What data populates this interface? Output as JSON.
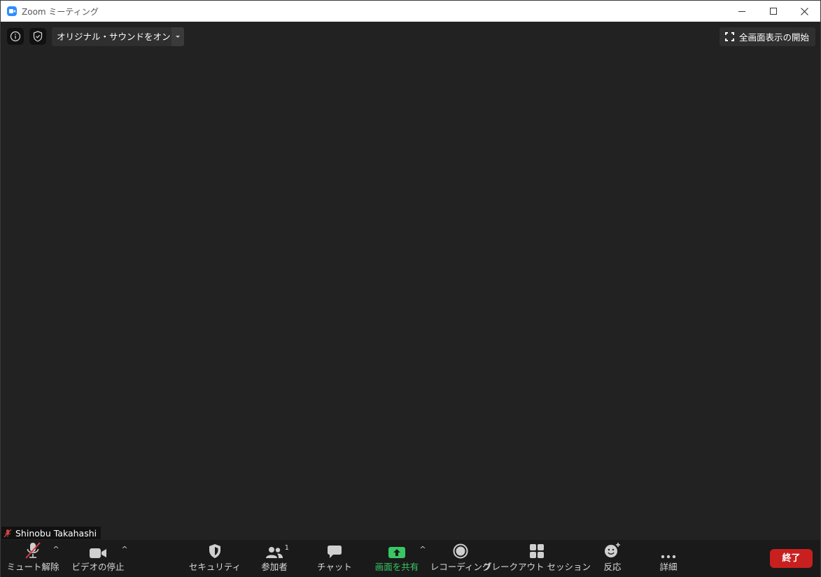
{
  "window": {
    "title": "Zoom ミーティング"
  },
  "top_bar": {
    "original_sound_label": "オリジナル・サウンドをオンにする",
    "fullscreen_label": "全画面表示の開始"
  },
  "participant": {
    "name": "Shinobu Takahashi",
    "muted": true
  },
  "toolbar": {
    "unmute_label": "ミュート解除",
    "stop_video_label": "ビデオの停止",
    "security_label": "セキュリティ",
    "participants_label": "参加者",
    "participants_count": "1",
    "chat_label": "チャット",
    "share_screen_label": "画面を共有",
    "recording_label": "レコーディング",
    "breakout_label": "ブレークアウト セッション",
    "reactions_label": "反応",
    "more_label": "詳細",
    "end_label": "終了"
  },
  "colors": {
    "share_green": "#38c764",
    "end_red": "#c8201f",
    "background": "#222222",
    "toolbar": "#1a1a1a"
  }
}
